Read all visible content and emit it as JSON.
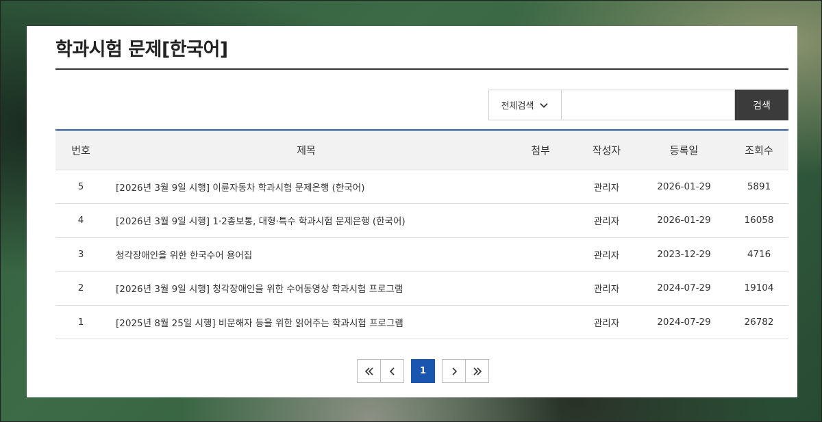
{
  "page_title": "학과시험 문제[한국어]",
  "search": {
    "select_label": "전체검색",
    "input_value": "",
    "button_label": "검색"
  },
  "table": {
    "headers": [
      "번호",
      "제목",
      "첨부",
      "작성자",
      "등록일",
      "조회수"
    ],
    "rows": [
      {
        "no": "5",
        "title": "[2026년 3월 9일 시행] 이륜자동차 학과시험 문제은행 (한국어)",
        "attach": "",
        "author": "관리자",
        "date": "2026-01-29",
        "views": "5891"
      },
      {
        "no": "4",
        "title": "[2026년 3월 9일 시행] 1·2종보통, 대형·특수 학과시험 문제은행 (한국어)",
        "attach": "",
        "author": "관리자",
        "date": "2026-01-29",
        "views": "16058"
      },
      {
        "no": "3",
        "title": "청각장애인을 위한 한국수어 용어집",
        "attach": "",
        "author": "관리자",
        "date": "2023-12-29",
        "views": "4716"
      },
      {
        "no": "2",
        "title": "[2026년 3월 9일 시행] 청각장애인을 위한 수어동영상 학과시험 프로그램",
        "attach": "",
        "author": "관리자",
        "date": "2024-07-29",
        "views": "19104"
      },
      {
        "no": "1",
        "title": "[2025년 8월 25일 시행] 비문해자 등을 위한 읽어주는 학과시험 프로그램",
        "attach": "",
        "author": "관리자",
        "date": "2024-07-29",
        "views": "26782"
      }
    ]
  },
  "pagination": {
    "current_page": "1",
    "icons": [
      "double-chevron-left-icon",
      "chevron-left-icon",
      "chevron-right-icon",
      "double-chevron-right-icon"
    ]
  },
  "colors": {
    "accent": "#1a55b0",
    "header_rule": "#2d5fae",
    "search_button": "#3b3b3b"
  }
}
